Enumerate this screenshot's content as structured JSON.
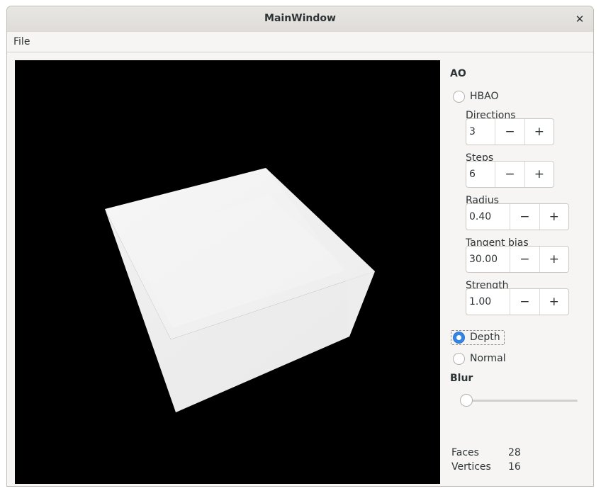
{
  "window": {
    "title": "MainWindow"
  },
  "menu": {
    "items": [
      {
        "label": "File"
      }
    ]
  },
  "ao": {
    "heading": "AO",
    "hbao": {
      "label": "HBAO",
      "checked": false,
      "fields": [
        {
          "label": "Directions",
          "value": "3"
        },
        {
          "label": "Steps",
          "value": "6"
        },
        {
          "label": "Radius",
          "value": "0.40"
        },
        {
          "label": "Tangent bias",
          "value": "30.00"
        },
        {
          "label": "Strength",
          "value": "1.00"
        }
      ]
    },
    "depth": {
      "label": "Depth",
      "checked": true
    },
    "normal": {
      "label": "Normal",
      "checked": false
    }
  },
  "blur": {
    "heading": "Blur",
    "value": 0
  },
  "stats": {
    "faces_label": "Faces",
    "faces_value": "28",
    "vertices_label": "Vertices",
    "vertices_value": "16"
  },
  "spin": {
    "minus": "−",
    "plus": "+"
  },
  "close_glyph": "✕",
  "colors": {
    "accent": "#3584e4",
    "viewport_bg": "#000000",
    "window_bg": "#f6f5f4"
  }
}
